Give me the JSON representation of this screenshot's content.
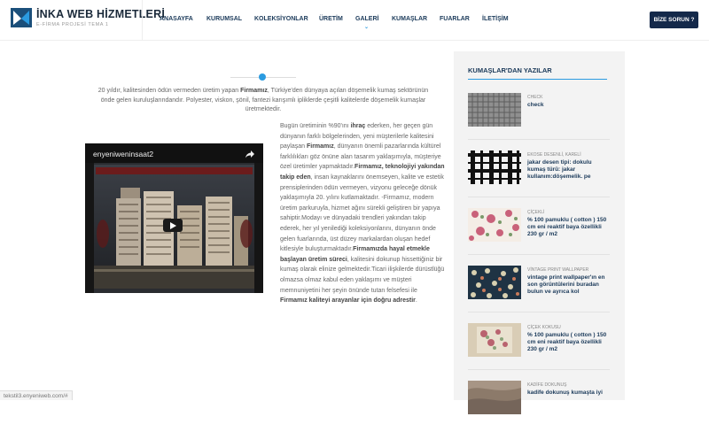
{
  "brand": {
    "title": "İNKA WEB HİZMETLERİ",
    "subtitle": "E-FİRMA PROJESİ TEMA 1"
  },
  "nav": {
    "items": [
      {
        "label": "ANASAYFA"
      },
      {
        "label": "KURUMSAL"
      },
      {
        "label": "KOLEKSİYONLAR"
      },
      {
        "label": "ÜRETİM"
      },
      {
        "label": "GALERİ"
      },
      {
        "label": "KUMAŞLAR"
      },
      {
        "label": "FUARLAR"
      },
      {
        "label": "İLETİŞİM"
      }
    ],
    "active": "GALERİ",
    "cta": "BİZE SORUN ?"
  },
  "intro": {
    "p1": "20 yıldır, kalitesinden ödün vermeden üretim yapan ",
    "b1": "Firmamız",
    "p2": ", Türkiye'den dünyaya açılan döşemelik kumaş sektörünün önde gelen kuruluşlarındandır. Polyester, viskon, şönil, fantezi karışımlı ipliklerde çeşitli kalitelerde döşemelik kumaşlar üretmektedir."
  },
  "video": {
    "title": "enyeniweninsaat2"
  },
  "body": {
    "s1": "Bugün üretiminin %90'ını ",
    "b1": "ihraç",
    "s2": " ederken, her geçen gün dünyanın farklı bölgelerinden, yeni müşterilerle kalitesini paylaşan ",
    "b2": "Firmamız",
    "s3": ", dünyanın önemli pazarlarında kültürel farklılıkları göz önüne alan tasarım yaklaşımıyla, müşteriye özel üretimler yapmaktadır.",
    "b3": "Firmamız, teknolojiyi yakından takip eden",
    "s4": ", insan kaynaklarını önemseyen, kalite ve estetik prensiplerinden ödün vermeyen, vizyonu geleceğe dönük yaklaşımıyla 20. yılını kutlamaktadır. -Firmamız, modern üretim parkuruyla, hizmet ağını sürekli geliştiren bir yapıya sahiptir.Modayı ve dünyadaki trendleri yakından takip ederek, her yıl yenilediği koleksiyonlarını, dünyanın önde gelen fuarlarında, üst düzey markalardan oluşan hedef kitlesiyle buluşturmaktadır.",
    "b4": "Firmamızda hayal etmekle başlayan üretim süreci",
    "s5": ", kalitesini dokunup hissettiğiniz bir kumaş olarak elinize gelmektedir.Ticari ilişkilerde dürüstlüğü olmazsa olmaz kabul eden yaklaşımı ve müşteri memnuniyetini her şeyin önünde tutan felsefesi ile ",
    "b5": "Firmamız kaliteyi arayanlar için doğru adrestir",
    "s6": "."
  },
  "sidebar": {
    "title": "KUMAŞLAR'DAN YAZILAR",
    "posts": [
      {
        "category": "CHECK",
        "title": "check",
        "thumb": "check"
      },
      {
        "category": "EKOSE DESENLİ, KARELİ",
        "title": " jakar desen tipi: dokulu kumaş türü: jakar kullanım:döşemelik. pe",
        "thumb": "plaid"
      },
      {
        "category": "ÇİÇEKLİ",
        "title": "% 100 pamuklu ( cotton ) 150 cm eni reaktif baya özellikli 230 gr / m2",
        "thumb": "floral"
      },
      {
        "category": "VİNTAGE PRINT WALLPAPER",
        "title": "vintage print wallpaper'ın en son görüntülerini buradan bulun ve ayrıca kol",
        "thumb": "vintage"
      },
      {
        "category": "ÇİÇEK KOKUSU",
        "title": "% 100 pamuklu ( cotton ) 150 cm eni reaktif baya özellikli 230 gr / m2",
        "thumb": "scent"
      },
      {
        "category": "KADİFE DOKUNUŞ",
        "title": "kadife dokunuş kumaşta iyi",
        "thumb": "velvet"
      }
    ]
  },
  "status": {
    "url": "tekstil3.enyeniweb.com/#"
  },
  "colors": {
    "navy": "#14294a",
    "accent": "#2b9be0",
    "sidebar_bg": "#f3f3f3"
  }
}
